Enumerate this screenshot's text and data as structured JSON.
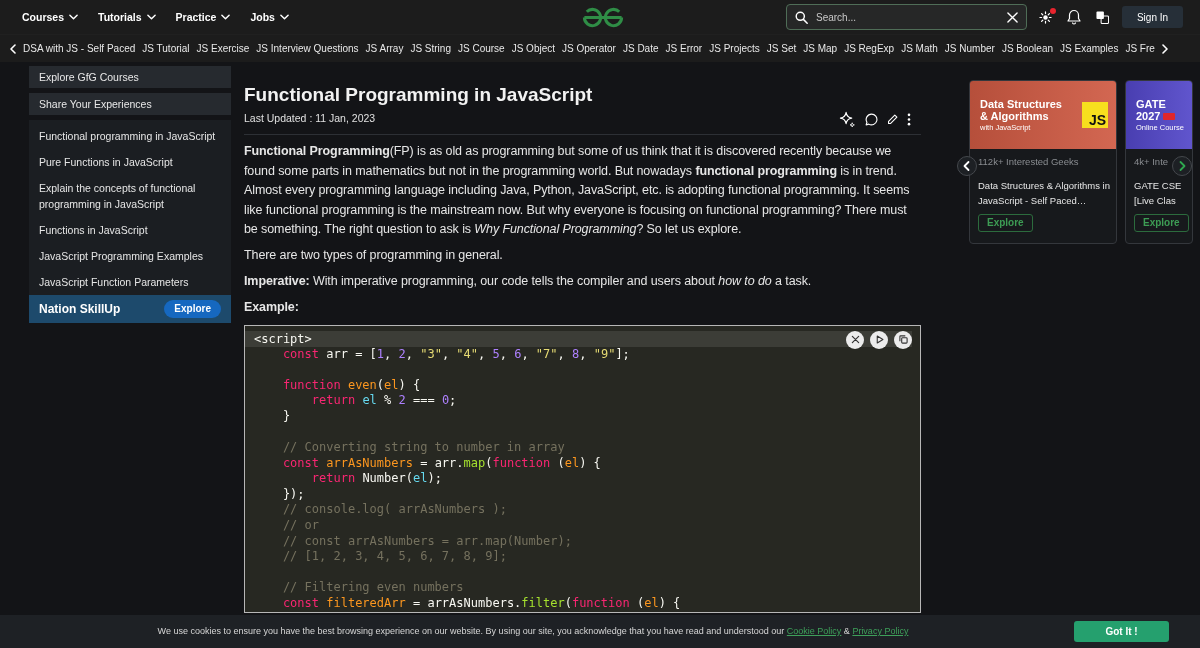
{
  "header": {
    "menus": [
      "Courses",
      "Tutorials",
      "Practice",
      "Jobs"
    ],
    "search": {
      "placeholder": "Search..."
    },
    "notification_dot": true,
    "sign_in": "Sign In"
  },
  "topics": [
    "DSA with JS - Self Paced",
    "JS Tutorial",
    "JS Exercise",
    "JS Interview Questions",
    "JS Array",
    "JS String",
    "JS Course",
    "JS Object",
    "JS Operator",
    "JS Date",
    "JS Error",
    "JS Projects",
    "JS Set",
    "JS Map",
    "JS RegExp",
    "JS Math",
    "JS Number",
    "JS Boolean",
    "JS Examples",
    "JS Fre"
  ],
  "sidebar": {
    "panels": [
      "Explore GfG Courses",
      "Share Your Experiences"
    ],
    "links": [
      "Functional programming in JavaScript",
      "Pure Functions in JavaScript",
      "Explain the concepts of functional programming in JavaScript",
      "Functions in JavaScript",
      "JavaScript Programming Examples",
      "JavaScript Function Parameters"
    ],
    "promo": {
      "title": "Nation SkillUp",
      "button": "Explore"
    }
  },
  "article": {
    "title": "Functional Programming in JavaScript",
    "updated": "Last Updated : 11 Jan, 2023",
    "blocks": [
      {
        "kind": "text",
        "text": "**Functional Programming**(FP) is as old as programming but some of us think that it is discovered recently because we found some parts in mathematics but not in the programming world. But nowadays **functional programming** is in trend. Almost every programming language including Java, Python, JavaScript, etc. is adopting functional programming. It seems like functional programming is the mainstream now. But why everyone is focusing on functional programming? There must be something. The right question to ask is *Why Functional Programming*? So let us explore."
      },
      {
        "kind": "text",
        "text": "There are two types of programming in general."
      },
      {
        "kind": "text",
        "text": "**Imperative:** With imperative programming, our code tells the compiler and users about *how to do* a task."
      },
      {
        "kind": "heading",
        "text": "Example:"
      }
    ]
  },
  "code": {
    "header": "<script>",
    "lines": [
      {
        "kind": "code",
        "tokens": [
          {
            "kind": "keyword",
            "text": "    const"
          },
          {
            "kind": "plain",
            "text": " arr = ["
          },
          {
            "kind": "number",
            "text": "1"
          },
          {
            "kind": "plain",
            "text": ", "
          },
          {
            "kind": "number",
            "text": "2"
          },
          {
            "kind": "plain",
            "text": ", "
          },
          {
            "kind": "string",
            "text": "\"3\""
          },
          {
            "kind": "plain",
            "text": ", "
          },
          {
            "kind": "string",
            "text": "\"4\""
          },
          {
            "kind": "plain",
            "text": ", "
          },
          {
            "kind": "number",
            "text": "5"
          },
          {
            "kind": "plain",
            "text": ", "
          },
          {
            "kind": "number",
            "text": "6"
          },
          {
            "kind": "plain",
            "text": ", "
          },
          {
            "kind": "string",
            "text": "\"7\""
          },
          {
            "kind": "plain",
            "text": ", "
          },
          {
            "kind": "number",
            "text": "8"
          },
          {
            "kind": "plain",
            "text": ", "
          },
          {
            "kind": "string",
            "text": "\"9\""
          },
          {
            "kind": "plain",
            "text": "];"
          }
        ]
      },
      {
        "kind": "blank"
      },
      {
        "kind": "code",
        "tokens": [
          {
            "kind": "keyword",
            "text": "    function "
          },
          {
            "kind": "name",
            "text": "even"
          },
          {
            "kind": "plain",
            "text": "("
          },
          {
            "kind": "name",
            "text": "el"
          },
          {
            "kind": "plain",
            "text": ") {"
          }
        ]
      },
      {
        "kind": "code",
        "tokens": [
          {
            "kind": "keyword",
            "text": "        return "
          },
          {
            "kind": "variable",
            "text": "el"
          },
          {
            "kind": "plain",
            "text": " % "
          },
          {
            "kind": "number",
            "text": "2"
          },
          {
            "kind": "plain",
            "text": " === "
          },
          {
            "kind": "number",
            "text": "0"
          },
          {
            "kind": "plain",
            "text": ";"
          }
        ]
      },
      {
        "kind": "code",
        "tokens": [
          {
            "kind": "plain",
            "text": "    }"
          }
        ]
      },
      {
        "kind": "blank"
      },
      {
        "kind": "code",
        "tokens": [
          {
            "kind": "comment",
            "text": "    // Converting string to number in array"
          }
        ]
      },
      {
        "kind": "code",
        "tokens": [
          {
            "kind": "keyword",
            "text": "    const "
          },
          {
            "kind": "name",
            "text": "arrAsNumbers"
          },
          {
            "kind": "plain",
            "text": " = arr."
          },
          {
            "kind": "method",
            "text": "map"
          },
          {
            "kind": "plain",
            "text": "("
          },
          {
            "kind": "keyword",
            "text": "function"
          },
          {
            "kind": "plain",
            "text": " ("
          },
          {
            "kind": "name",
            "text": "el"
          },
          {
            "kind": "plain",
            "text": ") {"
          }
        ]
      },
      {
        "kind": "code",
        "tokens": [
          {
            "kind": "keyword",
            "text": "        return"
          },
          {
            "kind": "plain",
            "text": " Number("
          },
          {
            "kind": "variable",
            "text": "el"
          },
          {
            "kind": "plain",
            "text": ");"
          }
        ]
      },
      {
        "kind": "code",
        "tokens": [
          {
            "kind": "plain",
            "text": "    });"
          }
        ]
      },
      {
        "kind": "code",
        "tokens": [
          {
            "kind": "comment",
            "text": "    // console.log( arrAsNumbers );"
          }
        ]
      },
      {
        "kind": "code",
        "tokens": [
          {
            "kind": "comment",
            "text": "    // or"
          }
        ]
      },
      {
        "kind": "code",
        "tokens": [
          {
            "kind": "comment",
            "text": "    // const arrAsNumbers = arr.map(Number);"
          }
        ]
      },
      {
        "kind": "code",
        "tokens": [
          {
            "kind": "comment",
            "text": "    // [1, 2, 3, 4, 5, 6, 7, 8, 9];"
          }
        ]
      },
      {
        "kind": "blank"
      },
      {
        "kind": "code",
        "tokens": [
          {
            "kind": "comment",
            "text": "    // Filtering even numbers"
          }
        ]
      },
      {
        "kind": "code",
        "tokens": [
          {
            "kind": "keyword",
            "text": "    const "
          },
          {
            "kind": "name",
            "text": "filteredArr"
          },
          {
            "kind": "plain",
            "text": " = arrAsNumbers."
          },
          {
            "kind": "method",
            "text": "filter"
          },
          {
            "kind": "plain",
            "text": "("
          },
          {
            "kind": "keyword",
            "text": "function"
          },
          {
            "kind": "plain",
            "text": " ("
          },
          {
            "kind": "name",
            "text": "el"
          },
          {
            "kind": "plain",
            "text": ") {"
          }
        ]
      }
    ]
  },
  "courses": [
    {
      "image": {
        "color": "#cf5a43",
        "title_lines": [
          "Data Structures",
          "& Algorithms"
        ],
        "subtitle": "with JavaScript",
        "badge": "JS",
        "ribbon": false
      },
      "interest": "112k+ Interested Geeks",
      "title": "Data Structures & Algorithms in JavaScript - Self Paced…",
      "button": "Explore"
    },
    {
      "image": {
        "color": "#5347c9",
        "title_lines": [
          "GATE",
          "2027"
        ],
        "subtitle": "Online Course",
        "ribbon": true
      },
      "interest": "4k+ Inte",
      "title": "GATE CSE [Live Clas",
      "button": "Explore"
    }
  ],
  "cookie_bar": {
    "message": "We use cookies to ensure you have the best browsing experience on our website. By using our site, you acknowledge that you have read and understood our",
    "links": [
      "Cookie Policy",
      "Privacy Policy"
    ],
    "joiner": "&",
    "button": "Got It !"
  }
}
